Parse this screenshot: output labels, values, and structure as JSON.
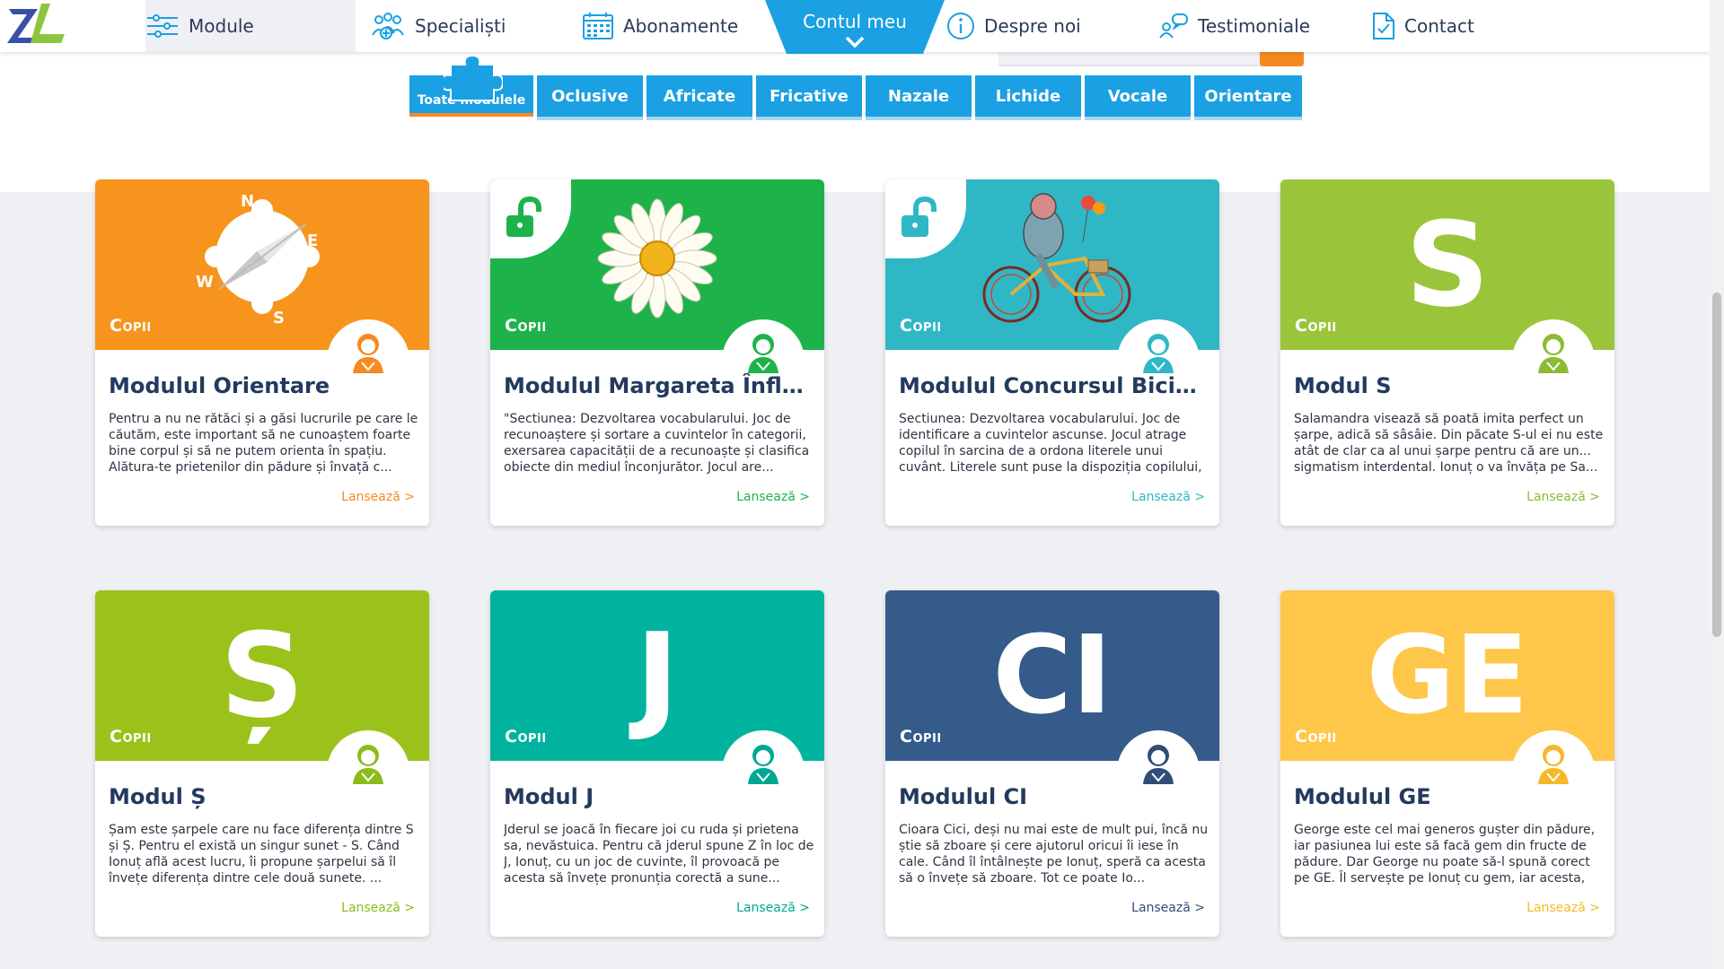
{
  "nav": {
    "items": [
      {
        "label": "Module"
      },
      {
        "label": "Specialiști"
      },
      {
        "label": "Abonamente"
      },
      {
        "label": "Contul meu"
      },
      {
        "label": "Despre noi"
      },
      {
        "label": "Testimoniale"
      },
      {
        "label": "Contact"
      }
    ],
    "accent": "#1aa0e3"
  },
  "filters": [
    {
      "label": "Toate modulele",
      "active": true
    },
    {
      "label": "Oclusive"
    },
    {
      "label": "Africate"
    },
    {
      "label": "Fricative"
    },
    {
      "label": "Nazale"
    },
    {
      "label": "Lichide"
    },
    {
      "label": "Vocale"
    },
    {
      "label": "Orientare"
    }
  ],
  "cards": [
    {
      "title": "Modulul Orientare",
      "kids": "Copii",
      "color": "#f7941d",
      "launch_color": "#f58a1f",
      "avatar_color": "#f58a1f",
      "icon": "compass-icon",
      "desc": "Pentru a nu ne rătăci și a găsi lucrurile pe care le căutăm, este important să ne cunoaștem foarte bine corpul și să ne putem orienta în spațiu. Alătura-te prietenilor din pădure și învață c...",
      "launch": "Lansează >",
      "compass": {
        "n": "N",
        "e": "E",
        "w": "W",
        "s": "S"
      }
    },
    {
      "title": "Modulul Margareta Înflorită",
      "kids": "Copii",
      "color": "#1db34a",
      "launch_color": "#1db34a",
      "avatar_color": "#1db34a",
      "icon": "daisy-icon",
      "locked": true,
      "desc": "\"Sectiunea: Dezvoltarea vocabularului. Joc de recunoaștere și sortare a cuvintelor în categorii, exersarea capacității de a recunoaște și clasifica obiecte din mediul înconjurător. Jocul are...",
      "launch": "Lansează >"
    },
    {
      "title": "Modulul Concursul Biciclișt...",
      "kids": "Copii",
      "color": "#2fb7c6",
      "launch_color": "#2fb7c6",
      "avatar_color": "#2fb7c6",
      "icon": "bicycle-icon",
      "locked": true,
      "desc": "Sectiunea: Dezvoltarea vocabularului. Joc de identificare a cuvintelor ascunse. Jocul atrage copilul în sarcina de a ordona literele unui cuvânt. Literele sunt puse la dispoziția copilului, ...",
      "launch": "Lansează >"
    },
    {
      "title": "Modul S",
      "kids": "Copii",
      "color": "#9ac53b",
      "launch_color": "#8dbb34",
      "avatar_color": "#8dbb34",
      "letter": "S",
      "desc": "Salamandra visează să poată imita perfect un șarpe, adică să sâsâie. Din păcate S-ul ei nu este atât de clar ca al unui șarpe pentru că are un... sigmatism interdental. Ionuț o va învăța pe Sa...",
      "launch": "Lansează >"
    },
    {
      "title": "Modul Ș",
      "kids": "Copii",
      "color": "#9bc21a",
      "launch_color": "#8dbb1a",
      "avatar_color": "#8dbb1a",
      "letter": "Ș",
      "desc": "Șam este șarpele care nu face diferența dintre S și Ș. Pentru el există un singur sunet - S. Când Ionuț află acest lucru, îi propune șarpelui să îl învețe diferența dintre cele două sunete. ...",
      "launch": "Lansează >"
    },
    {
      "title": "Modul J",
      "kids": "Copii",
      "color": "#00b39e",
      "launch_color": "#00a892",
      "avatar_color": "#00a892",
      "letter": "J",
      "desc": "Jderul se joacă în fiecare joi cu ruda și prietena sa, nevăstuica. Pentru că jderul spune Z în loc de J, Ionuț, cu un joc de cuvinte, îl provoacă pe acesta să învețe pronunția corectă a sune...",
      "launch": "Lansează >"
    },
    {
      "title": "Modulul CI",
      "kids": "Copii",
      "color": "#345b8a",
      "launch_color": "#2f4d76",
      "avatar_color": "#2f4d76",
      "letter": "CI",
      "desc": "Cioara Cici, deși nu mai este de mult pui, încă nu știe să zboare și cere ajutorul oricui îi iese în cale. Când îl întâlnește pe Ionuț, speră ca acesta să o învețe să zboare. Tot ce poate Io...",
      "launch": "Lansează >"
    },
    {
      "title": "Modulul GE",
      "kids": "Copii",
      "color": "#ffc74a",
      "launch_color": "#f5b82a",
      "avatar_color": "#f5b82a",
      "letter": "GE",
      "desc": "George este cel mai generos gușter din pădure, iar pasiunea lui este să facă gem din fructe de pădure. Dar George nu poate să-l spună corect pe GE. Îl servește pe Ionuț cu gem, iar acesta, d...",
      "launch": "Lansează >"
    }
  ]
}
